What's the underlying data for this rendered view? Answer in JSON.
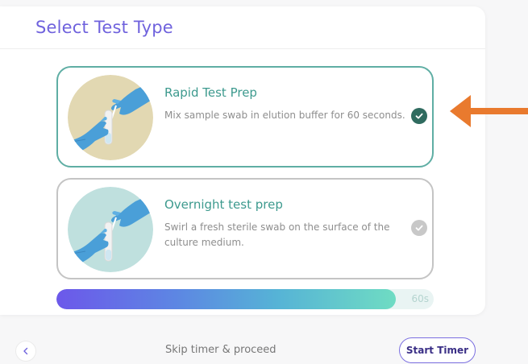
{
  "header": {
    "title": "Select Test Type"
  },
  "options": [
    {
      "title": "Rapid Test Prep",
      "description": "Mix sample swab in elution buffer for 60 seconds.",
      "selected": true,
      "image": "gloved-hands-swab-tube-illustration",
      "image_bg": "#e2d8b2"
    },
    {
      "title": "Overnight test prep",
      "description": "Swirl a fresh sterile swab on the surface of the culture medium.",
      "selected": false,
      "image": "gloved-hands-swab-tube-illustration",
      "image_bg": "#bfe0de"
    }
  ],
  "progress": {
    "label": "60s",
    "fraction": 0.9
  },
  "footer": {
    "back_icon": "chevron-left-icon",
    "skip_label": "Skip timer & proceed",
    "start_label": "Start Timer"
  },
  "annotation": {
    "arrow_color": "#e97a2e",
    "arrow_icon": "arrow-left-icon"
  },
  "colors": {
    "accent_purple": "#6f62dd",
    "accent_teal": "#3d9a8e",
    "selected_border": "#5faea4",
    "check_selected": "#2f6b5f",
    "glove_blue": "#4a9fd8"
  }
}
